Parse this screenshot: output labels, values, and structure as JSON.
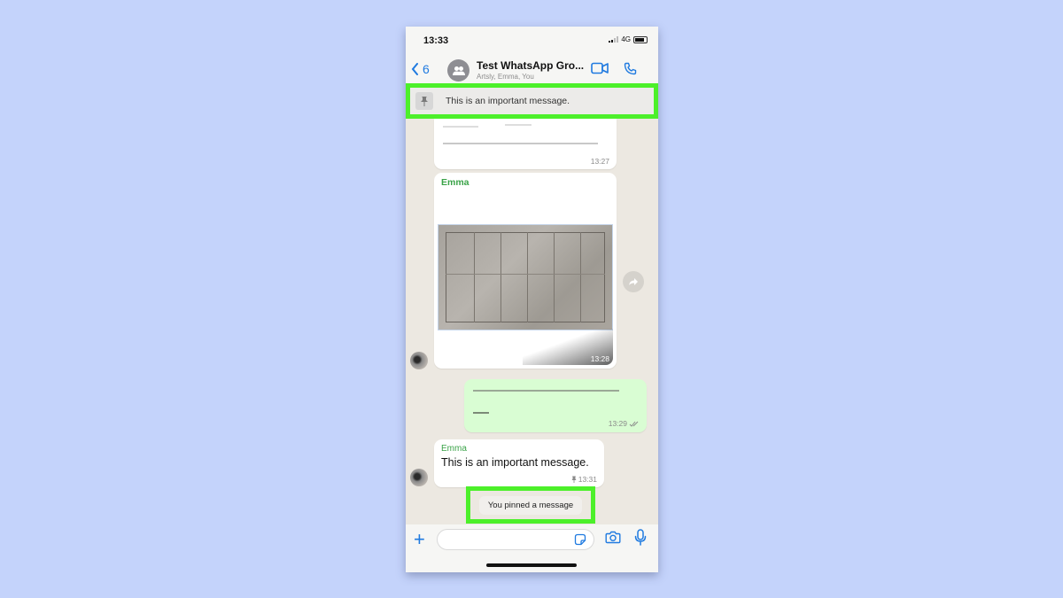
{
  "status_bar": {
    "time": "13:33",
    "network": "4G"
  },
  "header": {
    "back_count": "6",
    "title": "Test WhatsApp Gro...",
    "subtitle": "Artsly, Emma, You",
    "icons": [
      "video-call-icon",
      "phone-call-icon"
    ]
  },
  "pinned_banner": {
    "text": "This is an important message.",
    "icon": "pin-icon"
  },
  "messages": [
    {
      "direction": "in",
      "sender": "",
      "text": "[blurred text]",
      "time": "13:27"
    },
    {
      "direction": "in",
      "sender": "Emma",
      "type": "image",
      "time": "13:28"
    },
    {
      "direction": "out",
      "text": "[blurred text]",
      "time": "13:29",
      "status": "read"
    },
    {
      "direction": "in",
      "sender": "Emma",
      "text": "This is an important message.",
      "time": "13:31",
      "pinned": true
    }
  ],
  "system_message": "You pinned a message",
  "composer": {
    "placeholder": ""
  },
  "colors": {
    "accent": "#1f7ae0",
    "highlight": "#4cf02a",
    "sender": "#3aa348",
    "outgoing": "#d9fdd3"
  }
}
